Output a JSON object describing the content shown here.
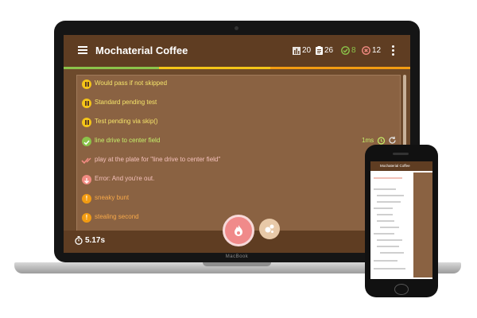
{
  "app": {
    "title": "Mochaterial Coffee",
    "stats": {
      "total": "20",
      "tests": "26",
      "passed": "8",
      "failed": "12"
    },
    "device_brand": "MacBook"
  },
  "tests": [
    {
      "status": "pending",
      "label": "Would pass if not skipped"
    },
    {
      "status": "pending",
      "label": "Standard pending test"
    },
    {
      "status": "pending",
      "label": "Test pending via skip()"
    },
    {
      "status": "passed",
      "label": "line drive to center field",
      "duration": "1ms"
    },
    {
      "status": "retry",
      "label": "play at the plate for \"line drive to center field\""
    },
    {
      "status": "error",
      "label": "Error: And you're out."
    },
    {
      "status": "warn",
      "label": "sneaky bunt"
    },
    {
      "status": "warn",
      "label": "stealing second"
    }
  ],
  "footer": {
    "duration": "5.17s"
  },
  "phone": {
    "title": "Mochaterial Coffee"
  },
  "colors": {
    "primary": "#5f3d22",
    "panel": "#8a6242",
    "pending": "#f5c518",
    "passed": "#8bc34a",
    "error": "#f28b82",
    "warn": "#f39c12"
  }
}
